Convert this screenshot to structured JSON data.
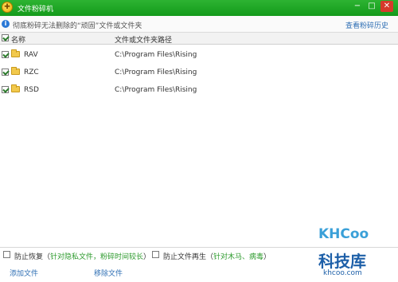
{
  "window": {
    "title": "文件粉碎机",
    "icon": "shredder-app-icon",
    "controls": [
      "minimize-icon",
      "maximize-icon",
      "close-icon"
    ]
  },
  "info": {
    "text": "彻底粉碎无法删除的“顽固”文件或文件夹",
    "history_link": "查看粉碎历史"
  },
  "table": {
    "headers": {
      "name": "名称",
      "path": "文件或文件夹路径"
    },
    "rows": [
      {
        "checked": true,
        "name": "RAV",
        "path": "C:\\Program Files\\Rising"
      },
      {
        "checked": true,
        "name": "RZC",
        "path": "C:\\Program Files\\Rising"
      },
      {
        "checked": true,
        "name": "RSD",
        "path": "C:\\Program Files\\Rising"
      }
    ]
  },
  "options": {
    "prevent_recovery": {
      "label": "防止恢复",
      "paren_open": "（",
      "note": "针对隐私文件，粉碎时间较长",
      "paren_close": "）",
      "checked": false
    },
    "prevent_regeneration": {
      "label": "防止文件再生",
      "paren_open": "（",
      "note": "针对木马、病毒",
      "paren_close": "）",
      "checked": false
    }
  },
  "footer": {
    "add_file": "添加文件",
    "remove_file": "移除文件"
  },
  "watermark": {
    "logo": "KHCoo",
    "brand": "科技库",
    "url": "khcoo.com"
  },
  "colors": {
    "titlebar": "#1fa825",
    "link": "#2f6fb4",
    "option_note": "#2c9a2c"
  }
}
